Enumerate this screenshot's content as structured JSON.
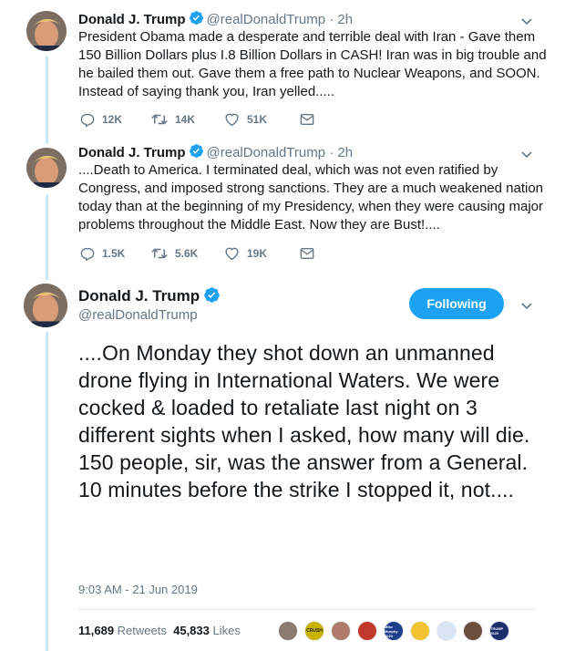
{
  "tweets": [
    {
      "name": "Donald J. Trump",
      "handle": "@realDonaldTrump",
      "time": "· 2h",
      "text": "President Obama made a desperate and terrible deal with Iran - Gave them 150 Billion Dollars plus I.8 Billion Dollars in CASH! Iran was in big trouble and he bailed them out. Gave them a free path to Nuclear Weapons, and SOON. Instead of saying thank you, Iran yelled.....",
      "replies": "12K",
      "retweets": "14K",
      "likes": "51K"
    },
    {
      "name": "Donald J. Trump",
      "handle": "@realDonaldTrump",
      "time": "· 2h",
      "text": "....Death to America. I terminated deal, which was not even ratified by Congress, and imposed strong sanctions. They are a much weakened nation today than at the beginning of my Presidency, when they were causing major problems throughout the Middle East. Now they are Bust!....",
      "replies": "1.5K",
      "retweets": "5.6K",
      "likes": "19K"
    }
  ],
  "main": {
    "name": "Donald J. Trump",
    "handle": "@realDonaldTrump",
    "follow_label": "Following",
    "text": "....On Monday they shot down an unmanned drone flying in International Waters. We were cocked & loaded to retaliate last night on 3 different sights when I asked, how many will die. 150 people, sir, was the answer from a General. 10 minutes before the strike I stopped it, not....",
    "timestamp": "9:03 AM - 21 Jun 2019",
    "retweet_count": "11,689",
    "retweet_label": "Retweets",
    "like_count": "45,833",
    "like_label": "Likes",
    "liker_badges": [
      "",
      "CRUSH",
      "",
      "",
      "Mike Murphy 2020",
      "",
      "",
      "",
      "TRUMP 2020"
    ]
  },
  "colors": {
    "accent": "#1da1f2",
    "secondary_text": "#657786",
    "thread_line": "#cce7f8"
  }
}
